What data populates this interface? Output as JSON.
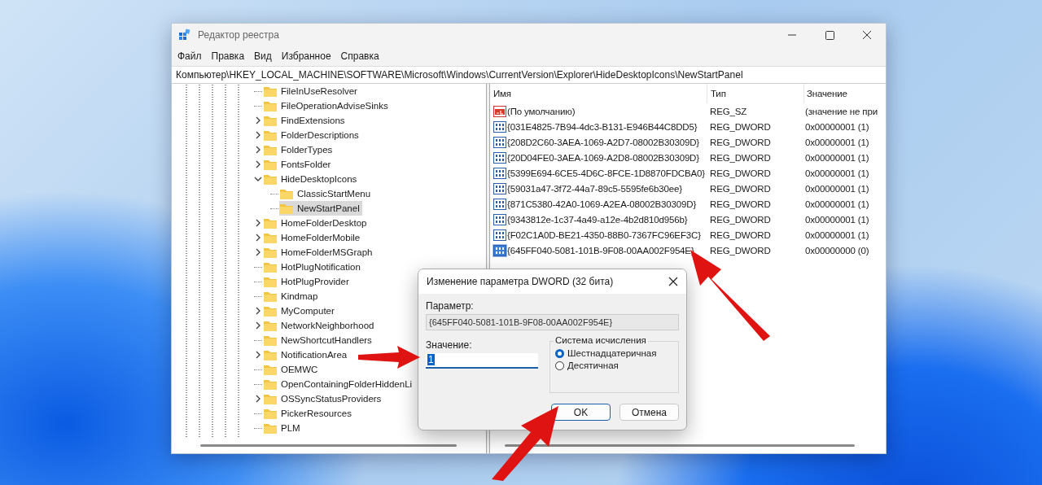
{
  "window": {
    "title": "Редактор реестра",
    "menu": [
      "Файл",
      "Правка",
      "Вид",
      "Избранное",
      "Справка"
    ],
    "address": "Компьютер\\HKEY_LOCAL_MACHINE\\SOFTWARE\\Microsoft\\Windows\\CurrentVersion\\Explorer\\HideDesktopIcons\\NewStartPanel"
  },
  "tree": {
    "items": [
      {
        "label": "FileInUseResolver",
        "kind": "leaf",
        "selected": false
      },
      {
        "label": "FileOperationAdviseSinks",
        "kind": "leaf",
        "selected": false
      },
      {
        "label": "FindExtensions",
        "kind": "branch",
        "expanded": false,
        "selected": false
      },
      {
        "label": "FolderDescriptions",
        "kind": "branch",
        "expanded": false,
        "selected": false
      },
      {
        "label": "FolderTypes",
        "kind": "branch",
        "expanded": false,
        "selected": false
      },
      {
        "label": "FontsFolder",
        "kind": "branch",
        "expanded": false,
        "selected": false
      },
      {
        "label": "HideDesktopIcons",
        "kind": "branch",
        "expanded": true,
        "selected": false,
        "children": [
          {
            "label": "ClassicStartMenu",
            "kind": "leaf",
            "selected": false
          },
          {
            "label": "NewStartPanel",
            "kind": "leaf",
            "selected": true
          }
        ]
      },
      {
        "label": "HomeFolderDesktop",
        "kind": "branch",
        "expanded": false,
        "selected": false
      },
      {
        "label": "HomeFolderMobile",
        "kind": "branch",
        "expanded": false,
        "selected": false
      },
      {
        "label": "HomeFolderMSGraph",
        "kind": "branch",
        "expanded": false,
        "selected": false
      },
      {
        "label": "HotPlugNotification",
        "kind": "leaf",
        "selected": false
      },
      {
        "label": "HotPlugProvider",
        "kind": "leaf",
        "selected": false
      },
      {
        "label": "Kindmap",
        "kind": "leaf",
        "selected": false
      },
      {
        "label": "MyComputer",
        "kind": "branch",
        "expanded": false,
        "selected": false
      },
      {
        "label": "NetworkNeighborhood",
        "kind": "branch",
        "expanded": false,
        "selected": false
      },
      {
        "label": "NewShortcutHandlers",
        "kind": "leaf",
        "selected": false
      },
      {
        "label": "NotificationArea",
        "kind": "branch",
        "expanded": false,
        "selected": false
      },
      {
        "label": "OEMWC",
        "kind": "leaf",
        "selected": false
      },
      {
        "label": "OpenContainingFolderHiddenLi",
        "kind": "leaf",
        "selected": false
      },
      {
        "label": "OSSyncStatusProviders",
        "kind": "branch",
        "expanded": false,
        "selected": false
      },
      {
        "label": "PickerResources",
        "kind": "leaf",
        "selected": false
      },
      {
        "label": "PLM",
        "kind": "leaf",
        "selected": false
      }
    ]
  },
  "list": {
    "columns": [
      "Имя",
      "Тип",
      "Значение"
    ],
    "rows": [
      {
        "name": "(По умолчанию)",
        "type": "REG_SZ",
        "data": "(значение не при",
        "kind": "string",
        "selected": false
      },
      {
        "name": "{031E4825-7B94-4dc3-B131-E946B44C8DD5}",
        "type": "REG_DWORD",
        "data": "0x00000001 (1)",
        "kind": "dword",
        "selected": false
      },
      {
        "name": "{208D2C60-3AEA-1069-A2D7-08002B30309D}",
        "type": "REG_DWORD",
        "data": "0x00000001 (1)",
        "kind": "dword",
        "selected": false
      },
      {
        "name": "{20D04FE0-3AEA-1069-A2D8-08002B30309D}",
        "type": "REG_DWORD",
        "data": "0x00000001 (1)",
        "kind": "dword",
        "selected": false
      },
      {
        "name": "{5399E694-6CE5-4D6C-8FCE-1D8870FDCBA0}",
        "type": "REG_DWORD",
        "data": "0x00000001 (1)",
        "kind": "dword",
        "selected": false
      },
      {
        "name": "{59031a47-3f72-44a7-89c5-5595fe6b30ee}",
        "type": "REG_DWORD",
        "data": "0x00000001 (1)",
        "kind": "dword",
        "selected": false
      },
      {
        "name": "{871C5380-42A0-1069-A2EA-08002B30309D}",
        "type": "REG_DWORD",
        "data": "0x00000001 (1)",
        "kind": "dword",
        "selected": false
      },
      {
        "name": "{9343812e-1c37-4a49-a12e-4b2d810d956b}",
        "type": "REG_DWORD",
        "data": "0x00000001 (1)",
        "kind": "dword",
        "selected": false
      },
      {
        "name": "{F02C1A0D-BE21-4350-88B0-7367FC96EF3C}",
        "type": "REG_DWORD",
        "data": "0x00000001 (1)",
        "kind": "dword",
        "selected": false
      },
      {
        "name": "{645FF040-5081-101B-9F08-00AA002F954E}",
        "type": "REG_DWORD",
        "data": "0x00000000 (0)",
        "kind": "dword",
        "selected": true
      }
    ]
  },
  "dialog": {
    "title": "Изменение параметра DWORD (32 бита)",
    "param_label": "Параметр:",
    "param_value": "{645FF040-5081-101B-9F08-00AA002F954E}",
    "value_label": "Значение:",
    "value": "1",
    "value_selected": true,
    "base": {
      "title": "Система исчисления",
      "options": [
        {
          "label": "Шестнадцатеричная",
          "selected": true
        },
        {
          "label": "Десятичная",
          "selected": false
        }
      ]
    },
    "buttons": [
      {
        "label": "OK",
        "default": true
      },
      {
        "label": "Отмена",
        "default": false
      }
    ]
  }
}
